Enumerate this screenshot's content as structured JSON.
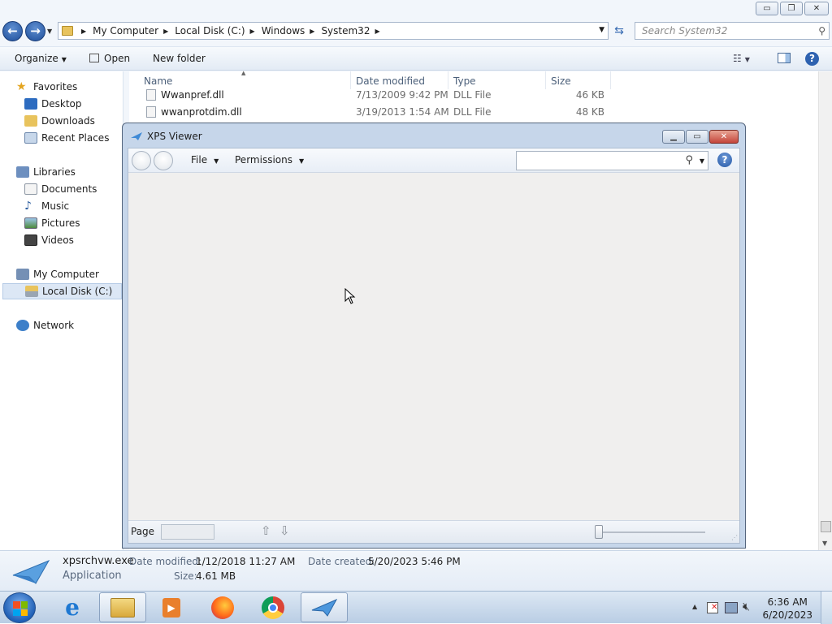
{
  "explorer": {
    "caption_buttons": {
      "minimize": "▭",
      "restore": "❐",
      "close": "✕"
    },
    "breadcrumb": [
      "My Computer",
      "Local Disk (C:)",
      "Windows",
      "System32"
    ],
    "search_placeholder": "Search System32",
    "toolbar": {
      "organize": "Organize",
      "open": "Open",
      "new_folder": "New folder"
    },
    "nav": {
      "favorites": "Favorites",
      "desktop": "Desktop",
      "downloads": "Downloads",
      "recent_places": "Recent Places",
      "libraries": "Libraries",
      "documents": "Documents",
      "music": "Music",
      "pictures": "Pictures",
      "videos": "Videos",
      "my_computer": "My Computer",
      "local_disk": "Local Disk (C:)",
      "network": "Network"
    },
    "columns": {
      "name": "Name",
      "date_modified": "Date modified",
      "type": "Type",
      "size": "Size"
    },
    "files": [
      {
        "name": "Wwanpref.dll",
        "date": "7/13/2009 9:42 PM",
        "type": "DLL File",
        "size": "46 KB"
      },
      {
        "name": "wwanprotdim.dll",
        "date": "3/19/2013 1:54 AM",
        "type": "DLL File",
        "size": "48 KB"
      }
    ],
    "details": {
      "filename": "xpsrchvw.exe",
      "kind": "Application",
      "date_modified_label": "Date modified:",
      "date_modified": "1/12/2018 11:27 AM",
      "size_label": "Size:",
      "size": "4.61 MB",
      "date_created_label": "Date created:",
      "date_created": "5/20/2023 5:46 PM"
    }
  },
  "xps_viewer": {
    "title": "XPS Viewer",
    "menus": {
      "file": "File",
      "permissions": "Permissions"
    },
    "help": "?",
    "status": {
      "page_label": "Page",
      "page_value": ""
    }
  },
  "taskbar": {
    "clock_time": "6:36 AM",
    "clock_date": "6/20/2023",
    "apps": [
      "internet-explorer",
      "windows-explorer",
      "media-player",
      "firefox",
      "chrome",
      "xps-viewer"
    ]
  },
  "colors": {
    "accent": "#1e4e9a",
    "xps_close": "#c4453a",
    "taskbar": "#b9cde4"
  }
}
